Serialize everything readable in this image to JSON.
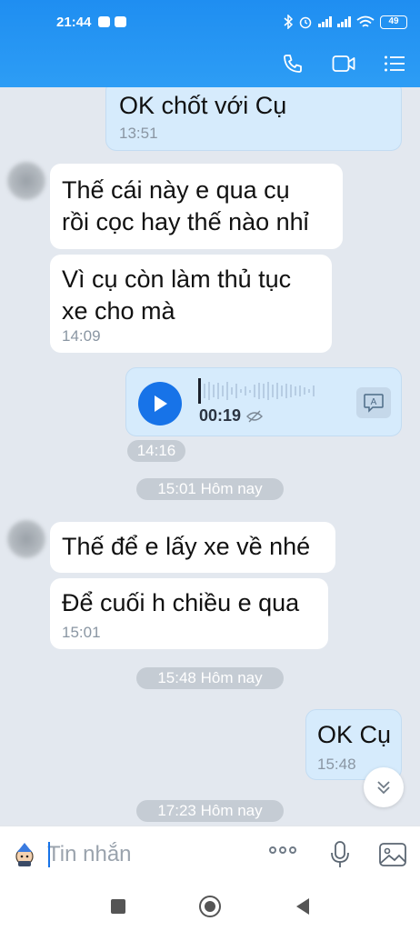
{
  "status": {
    "time": "21:44",
    "battery": "49"
  },
  "header": {
    "actions": [
      "phone-icon",
      "video-call-icon",
      "list-icon"
    ]
  },
  "messages": [
    {
      "side": "me",
      "text": "OK chốt với Cụ",
      "time": "13:51"
    },
    {
      "side": "other",
      "text": "Thế cái này e qua cụ\nrồi cọc hay thế nào nhỉ"
    },
    {
      "side": "other",
      "text": "Vì cụ còn làm thủ tục\nxe cho mà",
      "time": "14:09"
    },
    {
      "side": "me",
      "type": "voice",
      "duration": "00:19",
      "time": "14:16"
    },
    {
      "side": "other",
      "text": "Thế để e lấy xe về nhé"
    },
    {
      "side": "other",
      "text": "Để cuối h chiều e qua",
      "time": "15:01"
    },
    {
      "side": "me",
      "text": "OK Cụ",
      "time": "15:48"
    }
  ],
  "dividers": [
    "15:01 Hôm nay",
    "15:48 Hôm nay",
    "17:23 Hôm nay"
  ],
  "input": {
    "placeholder": "Tin nhắn"
  },
  "colors": {
    "accent": "#1773e8",
    "header": "#2d9df5",
    "my_bubble": "#d6ebfc",
    "background": "#e3e8ef"
  }
}
